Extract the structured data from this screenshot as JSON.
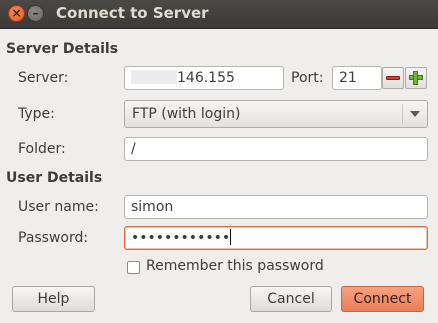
{
  "window": {
    "title": "Connect to Server",
    "close_glyph": "×",
    "minimize_glyph": "–"
  },
  "server_details": {
    "heading": "Server Details",
    "server_label": "Server:",
    "server_value": "146.155",
    "port_label": "Port:",
    "port_value": "21",
    "type_label": "Type:",
    "type_value": "FTP (with login)",
    "folder_label": "Folder:",
    "folder_value": "/"
  },
  "user_details": {
    "heading": "User Details",
    "username_label": "User name:",
    "username_value": "simon",
    "password_label": "Password:",
    "password_value": "••••••••••••",
    "remember_label": "Remember this password",
    "remember_checked": false
  },
  "buttons": {
    "help": "Help",
    "cancel": "Cancel",
    "connect": "Connect"
  },
  "colors": {
    "accent": "#ea7d56",
    "titlebar": "#3b3a36",
    "background": "#efeeec"
  }
}
